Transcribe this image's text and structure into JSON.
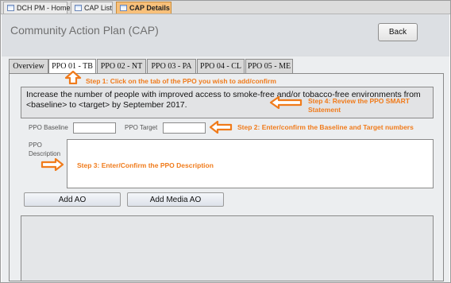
{
  "doc_tabs": [
    {
      "label": "DCH PM - Home",
      "icon": "form-icon"
    },
    {
      "label": "CAP List",
      "icon": "form-icon"
    },
    {
      "label": "CAP Details",
      "icon": "form-icon"
    }
  ],
  "header": {
    "title": "Community Action Plan (CAP)",
    "back_label": "Back"
  },
  "tabs": [
    "Overview",
    "PPO 01 - TB",
    "PPO 02 - NT",
    "PPO 03 - PA",
    "PPO 04 - CL",
    "PPO 05 - ME"
  ],
  "active_tab": "PPO 01 - TB",
  "smart_statement": "Increase the number of people with improved access to smoke-free and/or tobacco-free environments from <baseline> to <target> by September 2017.",
  "fields": {
    "baseline_label": "PPO Baseline",
    "target_label": "PPO Target",
    "description_label": "PPO Description"
  },
  "buttons": {
    "add_ao": "Add AO",
    "add_media_ao": "Add Media AO"
  },
  "annotations": {
    "step1": "Step 1: Click on the tab of the PPO you wish to add/confirm",
    "step2": "Step 2: Enter/confirm the Baseline and Target numbers",
    "step3": "Step 3: Enter/Confirm the PPO Description",
    "step4_line1": "Step 4: Review the PPO SMART",
    "step4_line2": "Statement"
  },
  "colors": {
    "annotation": "#f07b1b",
    "active_doc_tab": "#f8c07a"
  }
}
